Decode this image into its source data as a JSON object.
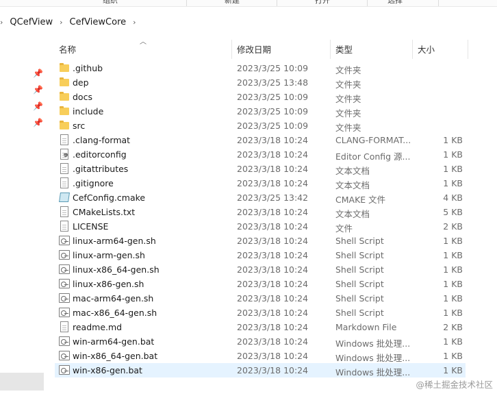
{
  "ribbon": {
    "groups": [
      "组织",
      "新建",
      "打开",
      "选择"
    ]
  },
  "breadcrumb": [
    "QCefView",
    "CefViewCore"
  ],
  "columns": {
    "name": "名称",
    "date": "修改日期",
    "type": "类型",
    "size": "大小"
  },
  "files": [
    {
      "name": ".github",
      "date": "2023/3/25 10:09",
      "type": "文件夹",
      "size": "",
      "icon": "folder"
    },
    {
      "name": "dep",
      "date": "2023/3/25 13:48",
      "type": "文件夹",
      "size": "",
      "icon": "folder"
    },
    {
      "name": "docs",
      "date": "2023/3/25 10:09",
      "type": "文件夹",
      "size": "",
      "icon": "folder"
    },
    {
      "name": "include",
      "date": "2023/3/25 10:09",
      "type": "文件夹",
      "size": "",
      "icon": "folder"
    },
    {
      "name": "src",
      "date": "2023/3/25 10:09",
      "type": "文件夹",
      "size": "",
      "icon": "folder"
    },
    {
      "name": ".clang-format",
      "date": "2023/3/18 10:24",
      "type": "CLANG-FORMAT...",
      "size": "1 KB",
      "icon": "file"
    },
    {
      "name": ".editorconfig",
      "date": "2023/3/18 10:24",
      "type": "Editor Config 源...",
      "size": "1 KB",
      "icon": "config"
    },
    {
      "name": ".gitattributes",
      "date": "2023/3/18 10:24",
      "type": "文本文档",
      "size": "1 KB",
      "icon": "file"
    },
    {
      "name": ".gitignore",
      "date": "2023/3/18 10:24",
      "type": "文本文档",
      "size": "1 KB",
      "icon": "file"
    },
    {
      "name": "CefConfig.cmake",
      "date": "2023/3/25 13:42",
      "type": "CMAKE 文件",
      "size": "4 KB",
      "icon": "cmake"
    },
    {
      "name": "CMakeLists.txt",
      "date": "2023/3/18 10:24",
      "type": "文本文档",
      "size": "5 KB",
      "icon": "file"
    },
    {
      "name": "LICENSE",
      "date": "2023/3/18 10:24",
      "type": "文件",
      "size": "2 KB",
      "icon": "blank"
    },
    {
      "name": "linux-arm64-gen.sh",
      "date": "2023/3/18 10:24",
      "type": "Shell Script",
      "size": "1 KB",
      "icon": "script"
    },
    {
      "name": "linux-arm-gen.sh",
      "date": "2023/3/18 10:24",
      "type": "Shell Script",
      "size": "1 KB",
      "icon": "script"
    },
    {
      "name": "linux-x86_64-gen.sh",
      "date": "2023/3/18 10:24",
      "type": "Shell Script",
      "size": "1 KB",
      "icon": "script"
    },
    {
      "name": "linux-x86-gen.sh",
      "date": "2023/3/18 10:24",
      "type": "Shell Script",
      "size": "1 KB",
      "icon": "script"
    },
    {
      "name": "mac-arm64-gen.sh",
      "date": "2023/3/18 10:24",
      "type": "Shell Script",
      "size": "1 KB",
      "icon": "script"
    },
    {
      "name": "mac-x86_64-gen.sh",
      "date": "2023/3/18 10:24",
      "type": "Shell Script",
      "size": "1 KB",
      "icon": "script"
    },
    {
      "name": "readme.md",
      "date": "2023/3/18 10:24",
      "type": "Markdown File",
      "size": "2 KB",
      "icon": "file"
    },
    {
      "name": "win-arm64-gen.bat",
      "date": "2023/3/18 10:24",
      "type": "Windows 批处理...",
      "size": "1 KB",
      "icon": "script"
    },
    {
      "name": "win-x86_64-gen.bat",
      "date": "2023/3/18 10:24",
      "type": "Windows 批处理...",
      "size": "1 KB",
      "icon": "script"
    },
    {
      "name": "win-x86-gen.bat",
      "date": "2023/3/18 10:24",
      "type": "Windows 批处理...",
      "size": "1 KB",
      "icon": "script",
      "selected": true
    }
  ],
  "watermark": "@稀土掘金技术社区"
}
